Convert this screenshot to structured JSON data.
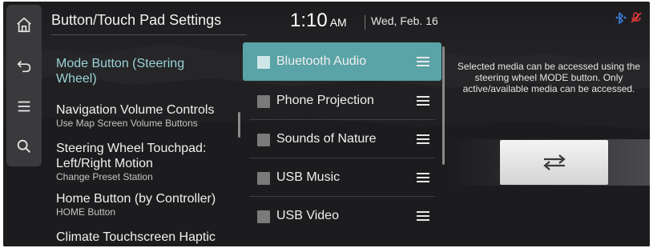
{
  "header": {
    "title": "Button/Touch Pad Settings",
    "time": "1:10",
    "ampm": "AM",
    "date": "Wed, Feb. 16"
  },
  "rail": {
    "icons": [
      "home-icon",
      "back-icon",
      "menu-icon",
      "search-icon"
    ]
  },
  "settings": {
    "items": [
      {
        "label": "Mode Button (Steering Wheel)",
        "sub": ""
      },
      {
        "label": "Navigation Volume Controls",
        "sub": "Use Map Screen Volume Buttons"
      },
      {
        "label": "Steering Wheel Touchpad: Left/Right Motion",
        "sub": "Change Preset Station"
      },
      {
        "label": "Home Button (by Controller)",
        "sub": "HOME Button"
      },
      {
        "label": "Climate Touchscreen Haptic",
        "sub": ""
      }
    ]
  },
  "media": {
    "items": [
      {
        "label": "Bluetooth Audio",
        "selected": true
      },
      {
        "label": "Phone Projection",
        "selected": false
      },
      {
        "label": "Sounds of Nature",
        "selected": false
      },
      {
        "label": "USB Music",
        "selected": false
      },
      {
        "label": "USB Video",
        "selected": false
      }
    ]
  },
  "description": "Selected media can be accessed using the steering wheel MODE button. Only active/available media can be accessed.",
  "status": {
    "icons": [
      "bluetooth-phone-icon",
      "mic-off-icon"
    ]
  },
  "colors": {
    "accent": "#5aa3a6",
    "active_text": "#9ad3d6",
    "status_red": "#e23a3a",
    "status_blue": "#3b7fe0"
  }
}
